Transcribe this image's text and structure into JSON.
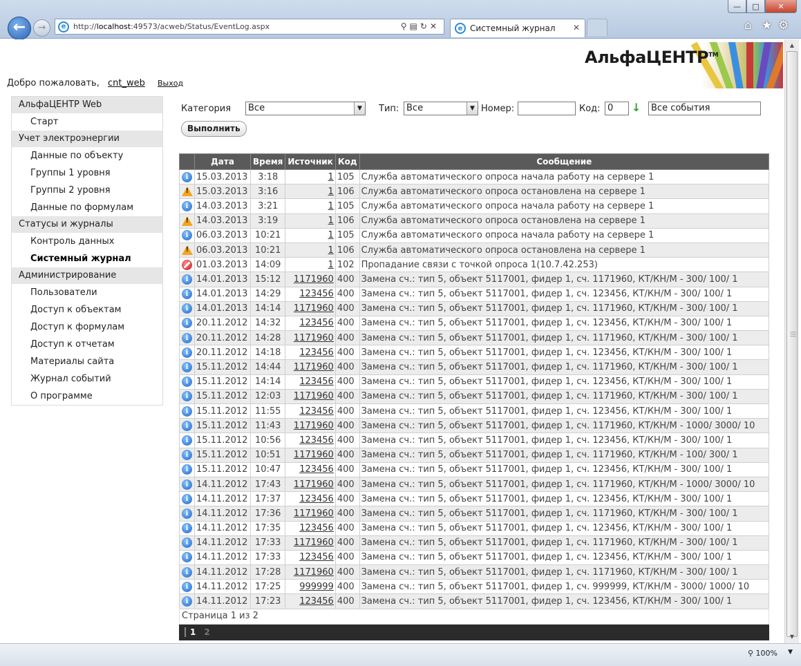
{
  "browser": {
    "url_prefix": "http://",
    "url_host": "localhost",
    "url_rest": ":49573/acweb/Status/EventLog.aspx",
    "tab_title": "Системный журнал",
    "zoom": "100%"
  },
  "header": {
    "logo_text": "АльфаЦЕНТР",
    "logo_tm": "TM",
    "welcome": "Добро пожаловать,",
    "username": "cnt_web",
    "logout": "Выход"
  },
  "sidebar": [
    {
      "title": "АльфаЦЕНТР Web",
      "items": [
        {
          "label": "Старт",
          "active": false
        }
      ]
    },
    {
      "title": "Учет электроэнергии",
      "items": [
        {
          "label": "Данные по объекту",
          "active": false
        },
        {
          "label": "Группы 1 уровня",
          "active": false
        },
        {
          "label": "Группы 2 уровня",
          "active": false
        },
        {
          "label": "Данные по формулам",
          "active": false
        }
      ]
    },
    {
      "title": "Статусы и журналы",
      "items": [
        {
          "label": "Контроль данных",
          "active": false
        },
        {
          "label": "Системный журнал",
          "active": true
        }
      ]
    },
    {
      "title": "Администрирование",
      "items": [
        {
          "label": "Пользователи",
          "active": false
        },
        {
          "label": "Доступ к объектам",
          "active": false
        },
        {
          "label": "Доступ к формулам",
          "active": false
        },
        {
          "label": "Доступ к отчетам",
          "active": false
        },
        {
          "label": "Материалы сайта",
          "active": false
        },
        {
          "label": "Журнал событий",
          "active": false
        },
        {
          "label": "О программе",
          "active": false
        }
      ]
    }
  ],
  "filters": {
    "category_label": "Категория",
    "category_value": "Все",
    "type_label": "Тип:",
    "type_value": "Все",
    "number_label": "Номер:",
    "number_value": "",
    "code_label": "Код:",
    "code_value": "0",
    "events_value": "Все события",
    "run_button": "Выполнить"
  },
  "table": {
    "columns": [
      "",
      "Дата",
      "Время",
      "Источник",
      "Код",
      "Сообщение"
    ],
    "rows": [
      {
        "icon": "info",
        "date": "15.03.2013",
        "time": "3:18",
        "source": "1",
        "code": "105",
        "message": "Служба автоматического опроса начала работу на сервере 1"
      },
      {
        "icon": "warning",
        "date": "15.03.2013",
        "time": "3:16",
        "source": "1",
        "code": "106",
        "message": "Служба автоматического опроса остановлена на сервере 1"
      },
      {
        "icon": "info",
        "date": "14.03.2013",
        "time": "3:21",
        "source": "1",
        "code": "105",
        "message": "Служба автоматического опроса начала работу на сервере 1"
      },
      {
        "icon": "warning",
        "date": "14.03.2013",
        "time": "3:19",
        "source": "1",
        "code": "106",
        "message": "Служба автоматического опроса остановлена на сервере 1"
      },
      {
        "icon": "info",
        "date": "06.03.2013",
        "time": "10:21",
        "source": "1",
        "code": "105",
        "message": "Служба автоматического опроса начала работу на сервере 1"
      },
      {
        "icon": "warning",
        "date": "06.03.2013",
        "time": "10:21",
        "source": "1",
        "code": "106",
        "message": "Служба автоматического опроса остановлена на сервере 1"
      },
      {
        "icon": "error",
        "date": "01.03.2013",
        "time": "14:09",
        "source": "1",
        "code": "102",
        "message": "Пропадание связи с точкой опроса 1(10.7.42.253)"
      },
      {
        "icon": "info",
        "date": "14.01.2013",
        "time": "15:12",
        "source": "1171960",
        "code": "400",
        "message": "Замена сч.: тип 5, объект 5117001, фидер 1, сч. 1171960, КТ/КН/М - 300/ 100/ 1"
      },
      {
        "icon": "info",
        "date": "14.01.2013",
        "time": "14:29",
        "source": "123456",
        "code": "400",
        "message": "Замена сч.: тип 5, объект 5117001, фидер 1, сч. 123456, КТ/КН/М - 300/ 100/ 1"
      },
      {
        "icon": "info",
        "date": "14.01.2013",
        "time": "14:14",
        "source": "1171960",
        "code": "400",
        "message": "Замена сч.: тип 5, объект 5117001, фидер 1, сч. 1171960, КТ/КН/М - 300/ 100/ 1"
      },
      {
        "icon": "info",
        "date": "20.11.2012",
        "time": "14:32",
        "source": "123456",
        "code": "400",
        "message": "Замена сч.: тип 5, объект 5117001, фидер 1, сч. 123456, КТ/КН/М - 300/ 100/ 1"
      },
      {
        "icon": "info",
        "date": "20.11.2012",
        "time": "14:28",
        "source": "1171960",
        "code": "400",
        "message": "Замена сч.: тип 5, объект 5117001, фидер 1, сч. 1171960, КТ/КН/М - 300/ 100/ 1"
      },
      {
        "icon": "info",
        "date": "20.11.2012",
        "time": "14:18",
        "source": "123456",
        "code": "400",
        "message": "Замена сч.: тип 5, объект 5117001, фидер 1, сч. 123456, КТ/КН/М - 300/ 100/ 1"
      },
      {
        "icon": "info",
        "date": "15.11.2012",
        "time": "14:44",
        "source": "1171960",
        "code": "400",
        "message": "Замена сч.: тип 5, объект 5117001, фидер 1, сч. 1171960, КТ/КН/М - 300/ 100/ 1"
      },
      {
        "icon": "info",
        "date": "15.11.2012",
        "time": "14:14",
        "source": "123456",
        "code": "400",
        "message": "Замена сч.: тип 5, объект 5117001, фидер 1, сч. 123456, КТ/КН/М - 300/ 100/ 1"
      },
      {
        "icon": "info",
        "date": "15.11.2012",
        "time": "12:03",
        "source": "1171960",
        "code": "400",
        "message": "Замена сч.: тип 5, объект 5117001, фидер 1, сч. 1171960, КТ/КН/М - 300/ 100/ 1"
      },
      {
        "icon": "info",
        "date": "15.11.2012",
        "time": "11:55",
        "source": "123456",
        "code": "400",
        "message": "Замена сч.: тип 5, объект 5117001, фидер 1, сч. 123456, КТ/КН/М - 300/ 100/ 1"
      },
      {
        "icon": "info",
        "date": "15.11.2012",
        "time": "11:43",
        "source": "1171960",
        "code": "400",
        "message": "Замена сч.: тип 5, объект 5117001, фидер 1, сч. 1171960, КТ/КН/М - 1000/ 3000/ 10"
      },
      {
        "icon": "info",
        "date": "15.11.2012",
        "time": "10:56",
        "source": "123456",
        "code": "400",
        "message": "Замена сч.: тип 5, объект 5117001, фидер 1, сч. 123456, КТ/КН/М - 300/ 100/ 1"
      },
      {
        "icon": "info",
        "date": "15.11.2012",
        "time": "10:51",
        "source": "1171960",
        "code": "400",
        "message": "Замена сч.: тип 5, объект 5117001, фидер 1, сч. 1171960, КТ/КН/М - 100/ 300/ 1"
      },
      {
        "icon": "info",
        "date": "15.11.2012",
        "time": "10:47",
        "source": "123456",
        "code": "400",
        "message": "Замена сч.: тип 5, объект 5117001, фидер 1, сч. 123456, КТ/КН/М - 300/ 100/ 1"
      },
      {
        "icon": "info",
        "date": "14.11.2012",
        "time": "17:43",
        "source": "1171960",
        "code": "400",
        "message": "Замена сч.: тип 5, объект 5117001, фидер 1, сч. 1171960, КТ/КН/М - 1000/ 3000/ 10"
      },
      {
        "icon": "info",
        "date": "14.11.2012",
        "time": "17:37",
        "source": "123456",
        "code": "400",
        "message": "Замена сч.: тип 5, объект 5117001, фидер 1, сч. 123456, КТ/КН/М - 300/ 100/ 1"
      },
      {
        "icon": "info",
        "date": "14.11.2012",
        "time": "17:36",
        "source": "1171960",
        "code": "400",
        "message": "Замена сч.: тип 5, объект 5117001, фидер 1, сч. 1171960, КТ/КН/М - 300/ 100/ 1"
      },
      {
        "icon": "info",
        "date": "14.11.2012",
        "time": "17:35",
        "source": "123456",
        "code": "400",
        "message": "Замена сч.: тип 5, объект 5117001, фидер 1, сч. 123456, КТ/КН/М - 300/ 100/ 1"
      },
      {
        "icon": "info",
        "date": "14.11.2012",
        "time": "17:33",
        "source": "1171960",
        "code": "400",
        "message": "Замена сч.: тип 5, объект 5117001, фидер 1, сч. 1171960, КТ/КН/М - 300/ 100/ 1"
      },
      {
        "icon": "info",
        "date": "14.11.2012",
        "time": "17:33",
        "source": "123456",
        "code": "400",
        "message": "Замена сч.: тип 5, объект 5117001, фидер 1, сч. 123456, КТ/КН/М - 300/ 100/ 1"
      },
      {
        "icon": "info",
        "date": "14.11.2012",
        "time": "17:28",
        "source": "1171960",
        "code": "400",
        "message": "Замена сч.: тип 5, объект 5117001, фидер 1, сч. 1171960, КТ/КН/М - 300/ 100/ 1"
      },
      {
        "icon": "info",
        "date": "14.11.2012",
        "time": "17:25",
        "source": "999999",
        "code": "400",
        "message": "Замена сч.: тип 5, объект 5117001, фидер 1, сч. 999999, КТ/КН/М - 3000/ 1000/ 10"
      },
      {
        "icon": "info",
        "date": "14.11.2012",
        "time": "17:23",
        "source": "123456",
        "code": "400",
        "message": "Замена сч.: тип 5, объект 5117001, фидер 1, сч. 123456, КТ/КН/М - 300/ 100/ 1"
      }
    ]
  },
  "pager": {
    "info": "Страница 1 из 2",
    "pages": [
      "1",
      "2"
    ],
    "current": "1"
  },
  "colors": {
    "header_bg": "#5a5a5a",
    "alt_row_bg": "#ececec",
    "pager_bg": "#2b2b2b"
  }
}
